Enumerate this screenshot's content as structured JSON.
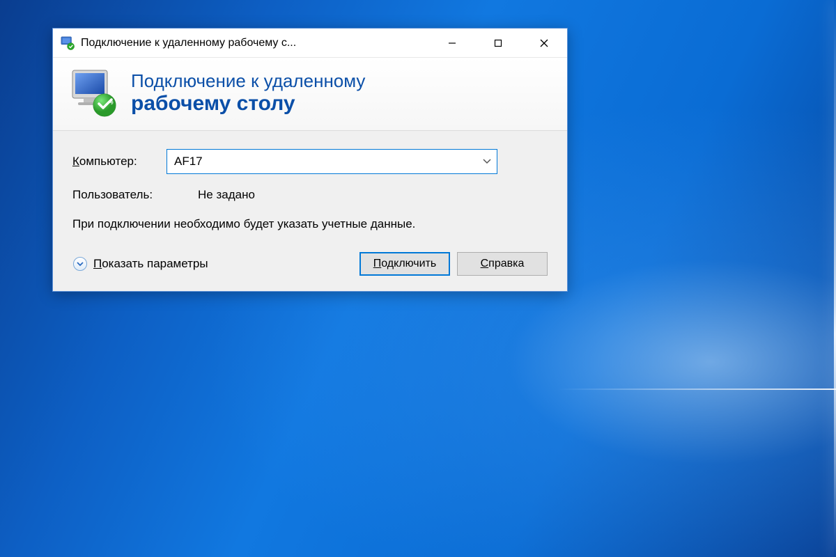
{
  "titlebar": {
    "title": "Подключение к удаленному рабочему с..."
  },
  "header": {
    "line1": "Подключение к удаленному",
    "line2": "рабочему столу"
  },
  "form": {
    "computer_label_underlined": "К",
    "computer_label_rest": "омпьютер:",
    "computer_value": "AF17",
    "user_label": "Пользователь:",
    "user_value": "Не задано",
    "info_text": "При подключении необходимо будет указать учетные данные."
  },
  "actions": {
    "show_options_underlined": "П",
    "show_options_rest": "оказать параметры",
    "connect_underlined": "П",
    "connect_rest": "одключить",
    "help_underlined": "С",
    "help_rest": "правка"
  }
}
